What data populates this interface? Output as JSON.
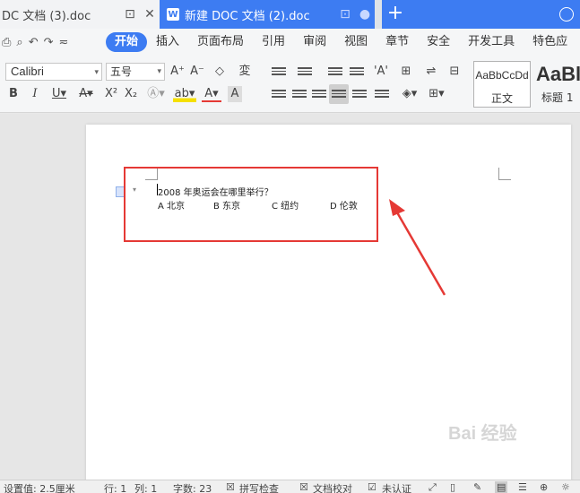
{
  "tabs": [
    {
      "title": "DC 文档 (3).doc",
      "active": false
    },
    {
      "title": "新建 DOC 文档 (2).doc",
      "active": true
    }
  ],
  "menu": {
    "items": [
      "开始",
      "插入",
      "页面布局",
      "引用",
      "审阅",
      "视图",
      "章节",
      "安全",
      "开发工具",
      "特色应"
    ],
    "active_index": 0
  },
  "ribbon": {
    "font_name": "Calibri",
    "font_size": "五号",
    "styles": [
      {
        "sample": "AaBbCcDd",
        "name": "正文"
      },
      {
        "sample": "AaBl",
        "name": "标题 1"
      }
    ]
  },
  "document": {
    "question": "2008 年奥运会在哪里举行？",
    "options": [
      "A 北京",
      "B 东京",
      "C 纽约",
      "D 伦敦"
    ]
  },
  "watermark": "Bai 经验",
  "statusbar": {
    "setting": "设置值: 2.5厘米",
    "row": "行: 1",
    "col": "列: 1",
    "chars": "字数: 23",
    "spell": "拼写检查",
    "proof": "文档校对",
    "cert": "未认证"
  },
  "colors": {
    "accent": "#3d7cf2",
    "highlight_border": "#e53935"
  }
}
